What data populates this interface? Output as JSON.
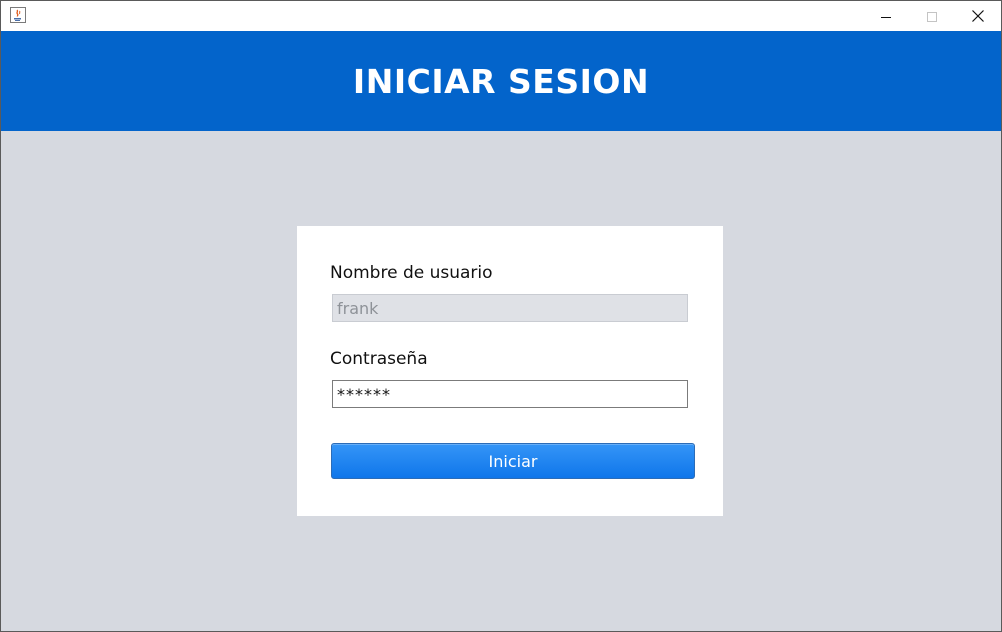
{
  "window": {
    "app_icon": "java-app-icon",
    "controls": {
      "minimize_icon": "minimize-icon",
      "maximize_icon": "maximize-icon",
      "close_icon": "close-icon"
    }
  },
  "header": {
    "title": "INICIAR SESION"
  },
  "login_form": {
    "username_label": "Nombre de usuario",
    "username_value": "frank",
    "password_label": "Contraseña",
    "password_value": "******",
    "submit_label": "Iniciar"
  },
  "colors": {
    "header_bg": "#0364cb",
    "page_bg": "#d6d9e0",
    "card_bg": "#ffffff",
    "button_bg": "#1a84f0"
  }
}
